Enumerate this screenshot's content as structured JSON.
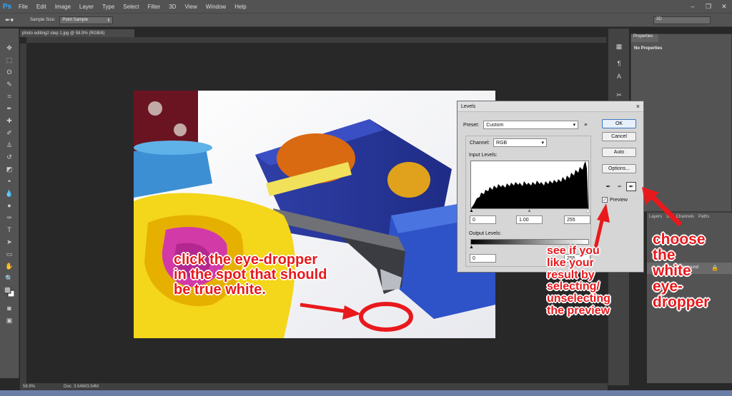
{
  "app": {
    "logo": "Ps",
    "menu": [
      "File",
      "Edit",
      "Image",
      "Layer",
      "Type",
      "Select",
      "Filter",
      "3D",
      "View",
      "Window",
      "Help"
    ]
  },
  "options_bar": {
    "sample_size_label": "Sample Size:",
    "sample_size_value": "Point Sample",
    "workspace": "3D"
  },
  "document": {
    "tab_title": "photo editing2 step 1.jpg @ 58.9% (RGB/8)",
    "zoom": "58.9%",
    "doc_info": "Doc: 3.54M/3.54M"
  },
  "panels": {
    "properties_tab": "Properties",
    "properties_title": "No Properties",
    "layers_tabs": [
      "Layers",
      "3D",
      "Channels",
      "Paths"
    ],
    "layer_name": "Background"
  },
  "levels_dialog": {
    "title": "Levels",
    "close": "×",
    "preset_label": "Preset:",
    "preset_value": "Custom",
    "channel_label": "Channel:",
    "channel_value": "RGB",
    "input_levels_label": "Input Levels:",
    "input_black": "0",
    "input_gamma": "1.00",
    "input_white": "255",
    "output_levels_label": "Output Levels:",
    "output_black": "0",
    "output_white": "255",
    "buttons": {
      "ok": "OK",
      "cancel": "Cancel",
      "auto": "Auto",
      "options": "Options..."
    },
    "preview_label": "Preview",
    "preview_checked": true
  },
  "annotations": {
    "click_dropper": "click the eye-dropper\nin the spot that should\nbe true white.",
    "see_preview": "see if you\nlike your\nresult by\nselecting/\nunselecting\nthe preview",
    "choose_white": "choose\nthe\nwhite\neye-\ndropper"
  },
  "colors": {
    "annotation_red": "#e8191d",
    "ui_dark": "#282828",
    "ui_panel": "#535353",
    "ps_blue": "#31a8ff"
  }
}
